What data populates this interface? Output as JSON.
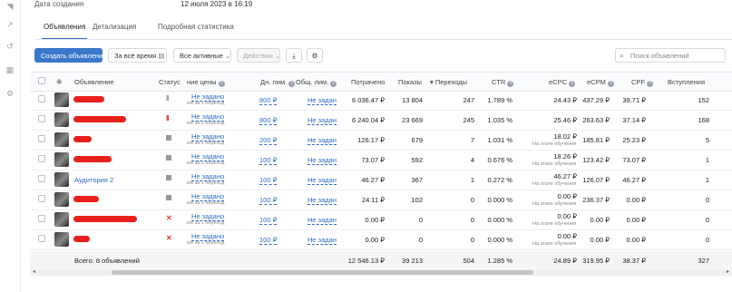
{
  "meta": {
    "created_label": "Дата создания",
    "created_value": "12 июля 2023 в 16:19"
  },
  "tabs": [
    "Объявления",
    "Детализация",
    "Подробная статистика"
  ],
  "toolbar": {
    "create": "Создать объявление",
    "period": "За всё время",
    "filter": "Все активные",
    "actions": "Действия",
    "search_placeholder": "Поиск объявлений"
  },
  "columns": {
    "ad": "Объявление",
    "status": "Статус",
    "price": "ние цены",
    "day_limit": "Дн. лим.",
    "total_limit": "Общ. лим.",
    "spent": "Потрачено",
    "impressions": "Показы",
    "clicks": "Переходы",
    "ctr": "CTR",
    "ecpc": "eCPC",
    "ecpm": "eCPM",
    "cpf": "CPF",
    "joins": "Вступления"
  },
  "colors": {
    "accent": "#3a78c9",
    "link": "#2b6cc4",
    "redaction": "#e8201c"
  },
  "rows": [
    {
      "name": "",
      "status": "pause",
      "price": "Не задано",
      "price_sub": "юе за 1 переход",
      "day_limit": "800 ₽",
      "total_limit": "Не задан",
      "spent": "6 036.47 ₽",
      "impressions": "13 804",
      "clicks": "247",
      "ctr": "1.789 %",
      "ecpc": "24.43 ₽",
      "ecpc_sub": "",
      "ecpm": "437.29 ₽",
      "cpf": "39.71 ₽",
      "joins": "152"
    },
    {
      "name": "",
      "status": "pause-red",
      "price": "Не задано",
      "price_sub": "юе за 1 переход",
      "day_limit": "800 ₽",
      "total_limit": "Не задан",
      "spent": "6 240.04 ₽",
      "impressions": "23 669",
      "clicks": "245",
      "ctr": "1.035 %",
      "ecpc": "25.46 ₽",
      "ecpc_sub": "",
      "ecpm": "263.63 ₽",
      "cpf": "37.14 ₽",
      "joins": "168"
    },
    {
      "name": "",
      "status": "stop",
      "price": "Не задано",
      "price_sub": "юе за 1 переход",
      "day_limit": "200 ₽",
      "total_limit": "Не задан",
      "spent": "126.17 ₽",
      "impressions": "679",
      "clicks": "7",
      "ctr": "1.031 %",
      "ecpc": "18.02 ₽",
      "ecpc_sub": "На этапе обучения",
      "ecpm": "185.81 ₽",
      "cpf": "25.23 ₽",
      "joins": "5"
    },
    {
      "name": "",
      "status": "stop",
      "price": "Не задано",
      "price_sub": "юе за 1 переход",
      "day_limit": "100 ₽",
      "total_limit": "Не задан",
      "spent": "73.07 ₽",
      "impressions": "592",
      "clicks": "4",
      "ctr": "0.676 %",
      "ecpc": "18.26 ₽",
      "ecpc_sub": "На этапе обучения",
      "ecpm": "123.42 ₽",
      "cpf": "73.07 ₽",
      "joins": "1"
    },
    {
      "name": "Аудитория 2",
      "status": "stop",
      "price": "Не задано",
      "price_sub": "юе за 1 переход",
      "day_limit": "100 ₽",
      "total_limit": "Не задан",
      "spent": "46.27 ₽",
      "impressions": "367",
      "clicks": "1",
      "ctr": "0.272 %",
      "ecpc": "46.27 ₽",
      "ecpc_sub": "На этапе обучения",
      "ecpm": "126.07 ₽",
      "cpf": "46.27 ₽",
      "joins": "1"
    },
    {
      "name": "",
      "status": "stop",
      "price": "Не задано",
      "price_sub": "юе за 1 переход",
      "day_limit": "100 ₽",
      "total_limit": "Не задан",
      "spent": "24.11 ₽",
      "impressions": "102",
      "clicks": "0",
      "ctr": "0.000 %",
      "ecpc": "0.00 ₽",
      "ecpc_sub": "На этапе обучения",
      "ecpm": "236.37 ₽",
      "cpf": "0.00 ₽",
      "joins": "0"
    },
    {
      "name": "",
      "status": "x",
      "price": "Не задано",
      "price_sub": "юе за 1 переход",
      "day_limit": "100 ₽",
      "total_limit": "Не задан",
      "spent": "0.00 ₽",
      "impressions": "0",
      "clicks": "0",
      "ctr": "0.000 %",
      "ecpc": "0.00 ₽",
      "ecpc_sub": "На этапе обучения",
      "ecpm": "0.00 ₽",
      "cpf": "0.00 ₽",
      "joins": "0"
    },
    {
      "name": "",
      "status": "x",
      "price": "Не задано",
      "price_sub": "юе за 1 переход",
      "day_limit": "100 ₽",
      "total_limit": "Не задан",
      "spent": "0.00 ₽",
      "impressions": "0",
      "clicks": "0",
      "ctr": "0.000 %",
      "ecpc": "0.00 ₽",
      "ecpc_sub": "На этапе обучения",
      "ecpm": "0.00 ₽",
      "cpf": "0.00 ₽",
      "joins": "0"
    }
  ],
  "totals": {
    "label": "Всего: 8 объявлений",
    "spent": "12 546.13 ₽",
    "impressions": "39 213",
    "clicks": "504",
    "ctr": "1.285 %",
    "ecpc": "24.89 ₽",
    "ecpm": "319.95 ₽",
    "cpf": "38.37 ₽",
    "joins": "327"
  }
}
